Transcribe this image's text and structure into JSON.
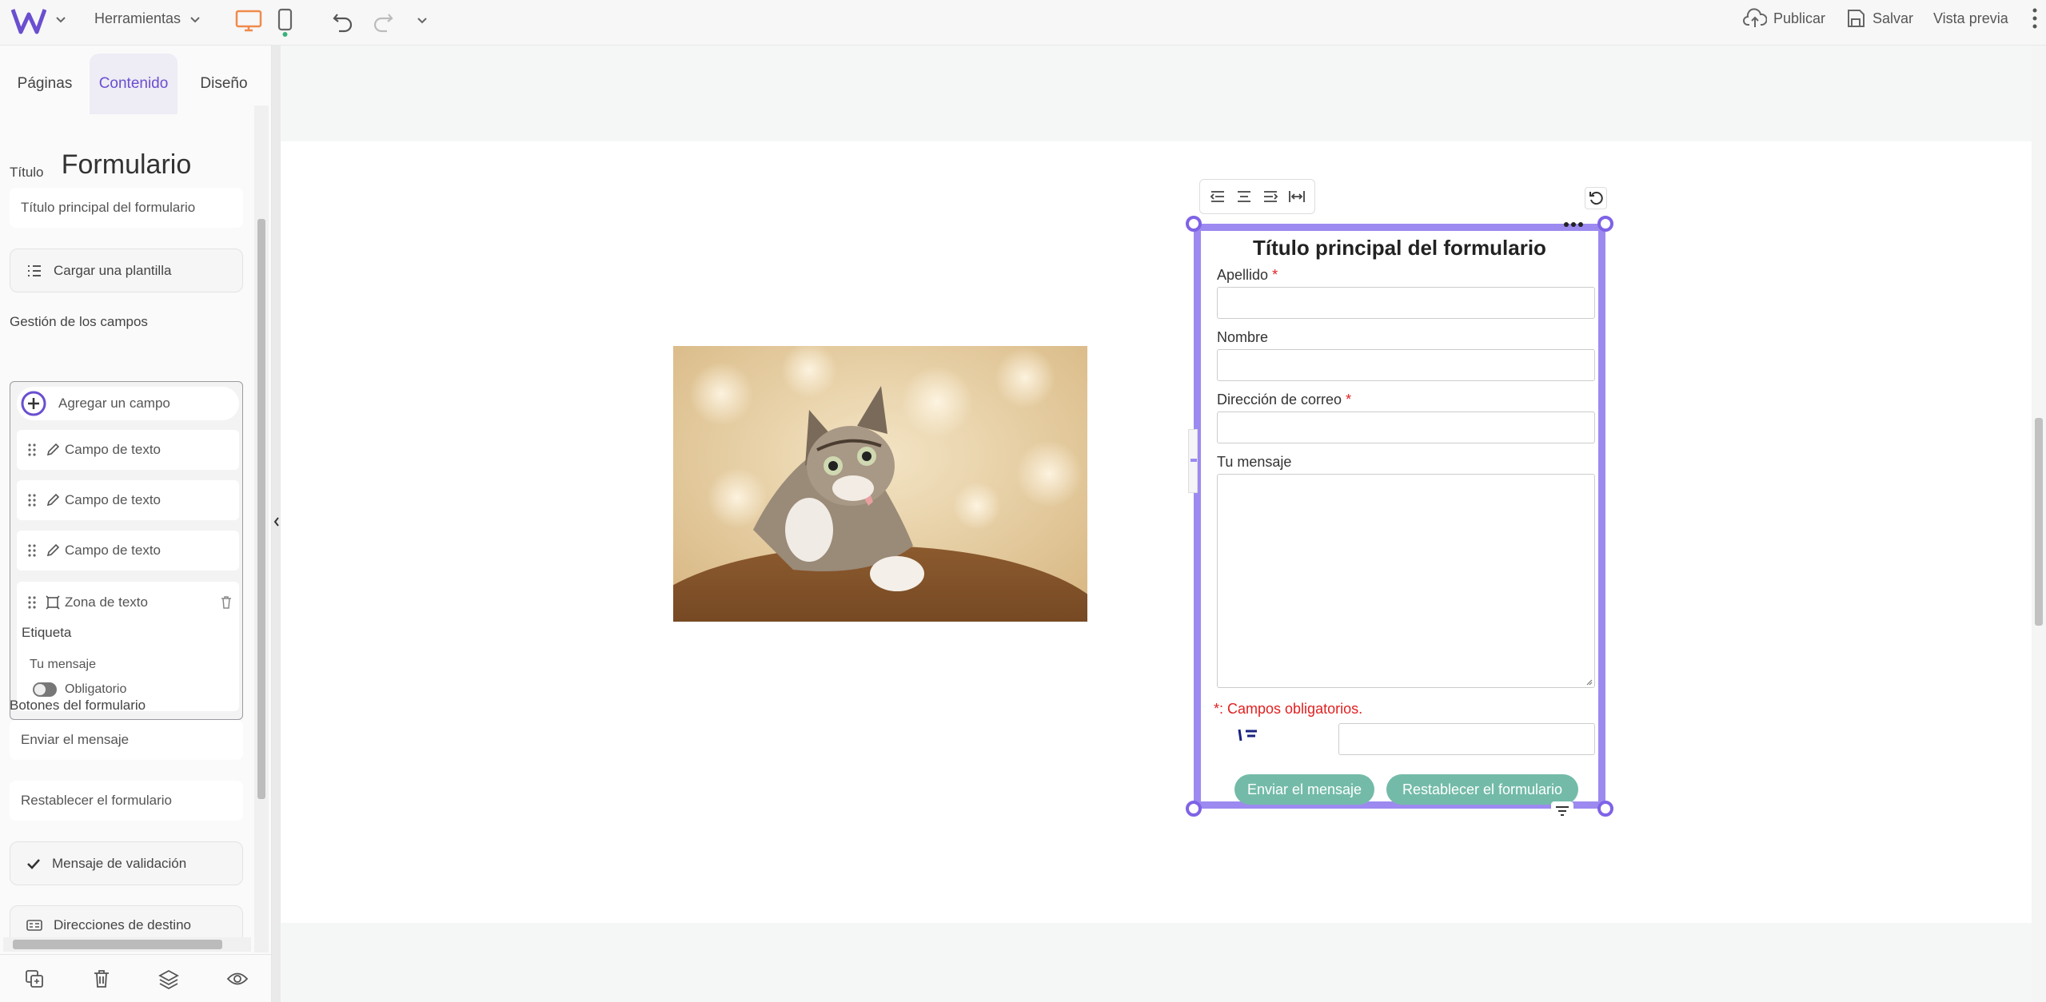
{
  "topbar": {
    "tools_label": "Herramientas",
    "publish_label": "Publicar",
    "save_label": "Salvar",
    "preview_label": "Vista previa"
  },
  "sidebar": {
    "tabs": [
      {
        "label": "Páginas"
      },
      {
        "label": "Contenido"
      },
      {
        "label": "Diseño"
      }
    ],
    "panel_title": "Formulario",
    "title_label": "Título",
    "title_value": "Título principal del formulario",
    "template_button": "Cargar una plantilla",
    "fields_section": "Gestión de los campos",
    "add_field": "Agregar un campo",
    "fields": [
      {
        "label": "Campo de texto"
      },
      {
        "label": "Campo de texto"
      },
      {
        "label": "Campo de texto"
      },
      {
        "label": "Zona de texto"
      }
    ],
    "expanded_field": {
      "label_caption": "Etiqueta",
      "label_value": "Tu mensaje",
      "required_label": "Obligatorio"
    },
    "buttons_section": "Botones del formulario",
    "send_button_value": "Enviar el mensaje",
    "reset_button_value": "Restablecer el formulario",
    "validation_message": "Mensaje de validación",
    "destinations": "Direcciones de destino"
  },
  "form": {
    "title": "Título principal del formulario",
    "field1_label": "Apellido",
    "field2_label": "Nombre",
    "field3_label": "Dirección de correo",
    "field4_label": "Tu mensaje",
    "required_star": "*",
    "required_note": "*: Campos obligatorios.",
    "send_button": "Enviar el mensaje",
    "reset_button": "Restablecer el formulario"
  },
  "colors": {
    "accent": "#6a4fcf",
    "selection": "#9d8af0",
    "form_button": "#73bba8",
    "required": "#e02020"
  }
}
